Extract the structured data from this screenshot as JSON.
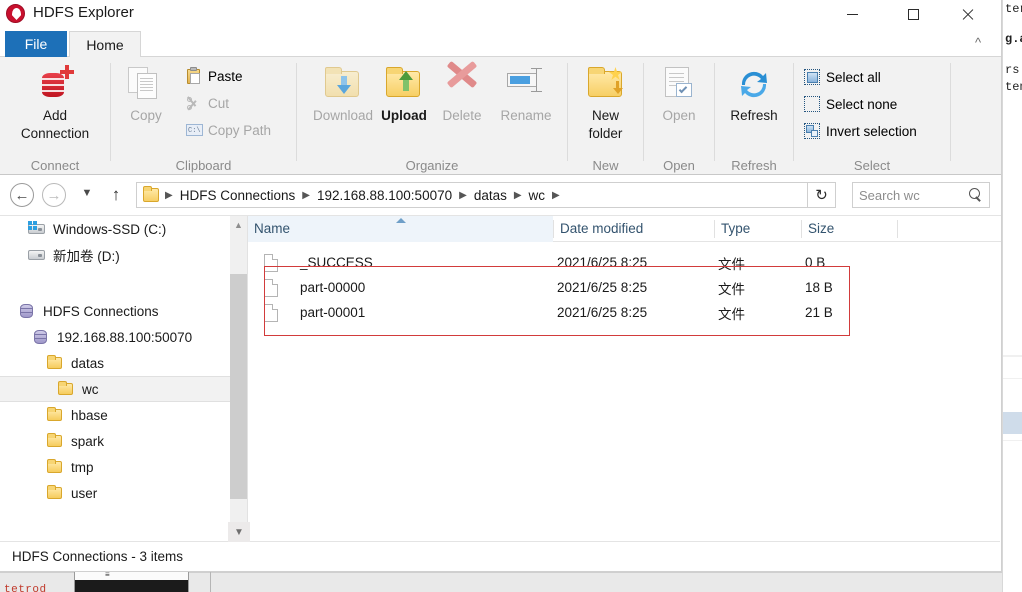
{
  "window": {
    "title": "HDFS Explorer",
    "logo_icon": "hdfs-explorer-logo-icon",
    "minimize_label": "Minimize",
    "maximize_label": "Maximize",
    "close_label": "Close"
  },
  "tabs": [
    {
      "label": "File",
      "active_style": "file"
    },
    {
      "label": "Home",
      "active_style": "home"
    }
  ],
  "ribbon": {
    "collapse_icon": "chevron-up-icon",
    "groups": [
      {
        "name": "Connect",
        "label": "Connect",
        "big_buttons": [
          {
            "label": "Add\nConnection",
            "line1": "Add",
            "line2": "Connection",
            "icon": "database-add-icon",
            "enabled": true
          }
        ],
        "small_buttons": []
      },
      {
        "name": "Clipboard",
        "label": "Clipboard",
        "big_buttons": [
          {
            "label": "Copy",
            "line1": "Copy",
            "line2": "",
            "icon": "copy-icon",
            "enabled": false
          }
        ],
        "small_buttons": [
          {
            "label": "Paste",
            "icon": "paste-icon",
            "enabled": true
          },
          {
            "label": "Cut",
            "icon": "scissors-icon",
            "enabled": false
          },
          {
            "label": "Copy Path",
            "icon": "copy-path-icon",
            "enabled": false
          }
        ]
      },
      {
        "name": "Organize",
        "label": "Organize",
        "big_buttons": [
          {
            "label": "Download",
            "line1": "Download",
            "line2": "",
            "icon": "folder-download-icon",
            "enabled": false
          },
          {
            "label": "Upload",
            "line1": "Upload",
            "line2": "",
            "icon": "folder-upload-icon",
            "enabled": true
          },
          {
            "label": "Delete",
            "line1": "Delete",
            "line2": "",
            "icon": "delete-x-icon",
            "enabled": false
          },
          {
            "label": "Rename",
            "line1": "Rename",
            "line2": "",
            "icon": "rename-icon",
            "enabled": false
          }
        ],
        "small_buttons": []
      },
      {
        "name": "New",
        "label": "New",
        "big_buttons": [
          {
            "label": "New folder",
            "line1": "New",
            "line2": "folder",
            "icon": "new-folder-icon",
            "enabled": true
          }
        ],
        "small_buttons": []
      },
      {
        "name": "Open",
        "label": "Open",
        "big_buttons": [
          {
            "label": "Open",
            "line1": "Open",
            "line2": "",
            "icon": "open-document-icon",
            "enabled": false
          }
        ],
        "small_buttons": []
      },
      {
        "name": "Refresh",
        "label": "Refresh",
        "big_buttons": [
          {
            "label": "Refresh",
            "line1": "Refresh",
            "line2": "",
            "icon": "refresh-arrows-icon",
            "enabled": true
          }
        ],
        "small_buttons": []
      },
      {
        "name": "Select",
        "label": "Select",
        "big_buttons": [],
        "small_buttons": [
          {
            "label": "Select all",
            "icon": "select-all-icon",
            "enabled": true
          },
          {
            "label": "Select none",
            "icon": "select-none-icon",
            "enabled": true
          },
          {
            "label": "Invert selection",
            "icon": "invert-selection-icon",
            "enabled": true
          }
        ]
      }
    ]
  },
  "address": {
    "back_icon": "arrow-left-icon",
    "forward_icon": "arrow-right-icon",
    "history_icon": "chevron-down-icon",
    "up_icon": "arrow-up-icon",
    "folder_icon": "folder-icon",
    "breadcrumbs": [
      "HDFS Connections",
      "192.168.88.100:50070",
      "datas",
      "wc"
    ],
    "refresh_icon": "refresh-icon",
    "search_placeholder": "Search wc",
    "search_value": "",
    "search_icon": "magnifier-icon"
  },
  "navpane": {
    "items": [
      {
        "label": "Windows-SSD (C:)",
        "icon": "drive-windows-icon",
        "indent": 1,
        "selected": false
      },
      {
        "label": "新加卷 (D:)",
        "icon": "drive-icon",
        "indent": 1,
        "selected": false
      },
      {
        "label": "",
        "icon": "spacer",
        "indent": 0,
        "selected": false
      },
      {
        "label": "HDFS Connections",
        "icon": "database-icon",
        "indent": 0,
        "selected": false
      },
      {
        "label": "192.168.88.100:50070",
        "icon": "database-icon",
        "indent": 1,
        "selected": false
      },
      {
        "label": "datas",
        "icon": "folder-icon",
        "indent": 2,
        "selected": false
      },
      {
        "label": "wc",
        "icon": "folder-icon",
        "indent": 3,
        "selected": true
      },
      {
        "label": "hbase",
        "icon": "folder-icon",
        "indent": 2,
        "selected": false
      },
      {
        "label": "spark",
        "icon": "folder-icon",
        "indent": 2,
        "selected": false
      },
      {
        "label": "tmp",
        "icon": "folder-icon",
        "indent": 2,
        "selected": false
      },
      {
        "label": "user",
        "icon": "folder-icon",
        "indent": 2,
        "selected": false
      }
    ],
    "scrollbar": {
      "up_icon": "chevron-up-icon",
      "down_icon": "chevron-down-icon"
    }
  },
  "filelist": {
    "columns": [
      {
        "key": "name",
        "label": "Name",
        "sorted": true,
        "sort_dir": "asc"
      },
      {
        "key": "date",
        "label": "Date modified",
        "sorted": false,
        "sort_dir": ""
      },
      {
        "key": "type",
        "label": "Type",
        "sorted": false,
        "sort_dir": ""
      },
      {
        "key": "size",
        "label": "Size",
        "sorted": false,
        "sort_dir": ""
      }
    ],
    "rows": [
      {
        "icon": "file-icon",
        "name": "_SUCCESS",
        "date": "2021/6/25 8:25",
        "type": "文件",
        "size": "0 B"
      },
      {
        "icon": "file-icon",
        "name": "part-00000",
        "date": "2021/6/25 8:25",
        "type": "文件",
        "size": "18 B"
      },
      {
        "icon": "file-icon",
        "name": "part-00001",
        "date": "2021/6/25 8:25",
        "type": "文件",
        "size": "21 B"
      }
    ],
    "annotation": {
      "color": "#d23b3b",
      "shape": "rectangle"
    }
  },
  "statusbar": {
    "text": "HDFS Connections - 3 items",
    "collapse_icon": "chevron-down-icon"
  },
  "background": {
    "right_window_lines": [
      "ter",
      "g.a",
      "rs",
      "ten"
    ],
    "bottom_text": "tetrod"
  },
  "colors": {
    "accent_blue": "#1d70b8",
    "ribbon_bg": "#f2f2f2",
    "annotation_red": "#d23b3b",
    "header_text": "#33536e",
    "disabled_text": "#a6a6a6"
  }
}
